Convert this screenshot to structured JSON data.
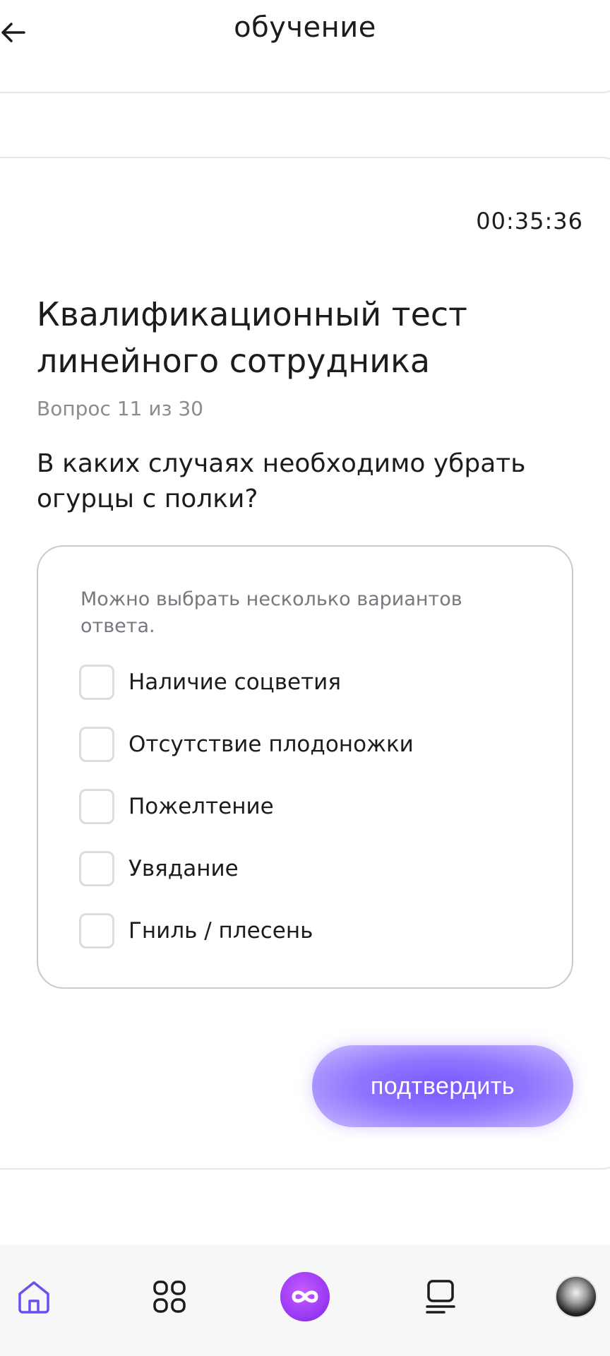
{
  "header": {
    "title": "обучение"
  },
  "quiz": {
    "timer": "00:35:36",
    "title": "Квалификационный тест линейного сотрудника",
    "counter": "Вопрос 11 из 30",
    "question": "В каких случаях необходимо убрать огурцы с полки?",
    "hint": "Можно выбрать несколько вариантов ответа.",
    "options": [
      {
        "label": "Наличие соцветия",
        "checked": false
      },
      {
        "label": "Отсутствие плодоножки",
        "checked": false
      },
      {
        "label": "Пожелтение",
        "checked": false
      },
      {
        "label": "Увядание",
        "checked": false
      },
      {
        "label": "Гниль / плесень",
        "checked": false
      }
    ],
    "confirm_label": "подтвердить"
  },
  "nav": {
    "items": [
      {
        "icon": "home-icon",
        "active": true
      },
      {
        "icon": "apps-grid-icon",
        "active": false
      },
      {
        "icon": "infinity-logo-icon",
        "active": false
      },
      {
        "icon": "courses-stack-icon",
        "active": false
      },
      {
        "icon": "avatar",
        "active": false
      }
    ]
  },
  "colors": {
    "accent": "#7b57ff",
    "nav_active": "#6c4ef0",
    "logo": "#a03cf6",
    "muted_text": "#8b8b92",
    "border": "#c9c9ce"
  }
}
